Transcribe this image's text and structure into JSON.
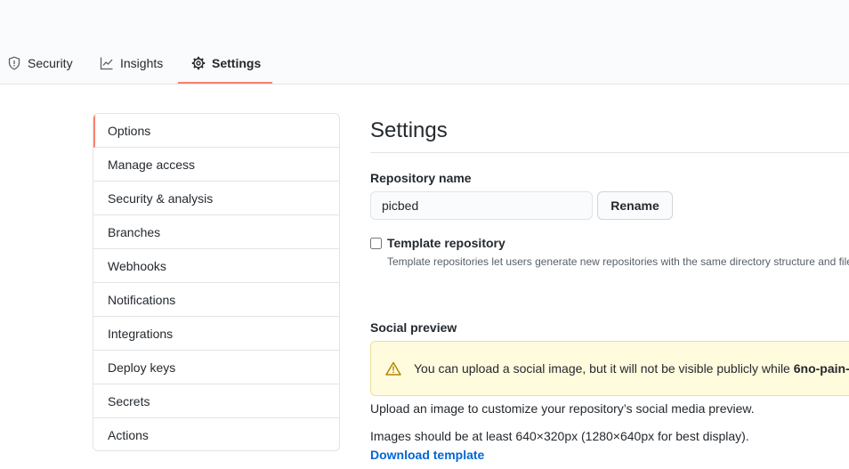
{
  "nav": {
    "tabs": [
      {
        "label": "Security",
        "icon": "shield-icon"
      },
      {
        "label": "Insights",
        "icon": "graph-icon"
      },
      {
        "label": "Settings",
        "icon": "gear-icon",
        "selected": true
      }
    ]
  },
  "sidebar": {
    "items": [
      {
        "label": "Options",
        "selected": true
      },
      {
        "label": "Manage access"
      },
      {
        "label": "Security & analysis"
      },
      {
        "label": "Branches"
      },
      {
        "label": "Webhooks"
      },
      {
        "label": "Notifications"
      },
      {
        "label": "Integrations"
      },
      {
        "label": "Deploy keys"
      },
      {
        "label": "Secrets"
      },
      {
        "label": "Actions"
      }
    ]
  },
  "main": {
    "title": "Settings",
    "repo_name_label": "Repository name",
    "repo_name_value": "picbed",
    "rename_label": "Rename",
    "template_label": "Template repository",
    "template_note": "Template repositories let users generate new repositories with the same directory structure and files.",
    "social_preview_label": "Social preview",
    "flash_text": "You can upload a social image, but it will not be visible publicly while",
    "flash_bold": "6no-pain-",
    "upload_text": "Upload an image to customize your repository’s social media preview.",
    "size_text": "Images should be at least 640×320px (1280×640px for best display).",
    "download_link": "Download template"
  },
  "colors": {
    "accent_underline": "#f9826c",
    "link": "#0366d6",
    "flash_bg": "#fffbdd",
    "border": "#e1e4e8"
  }
}
